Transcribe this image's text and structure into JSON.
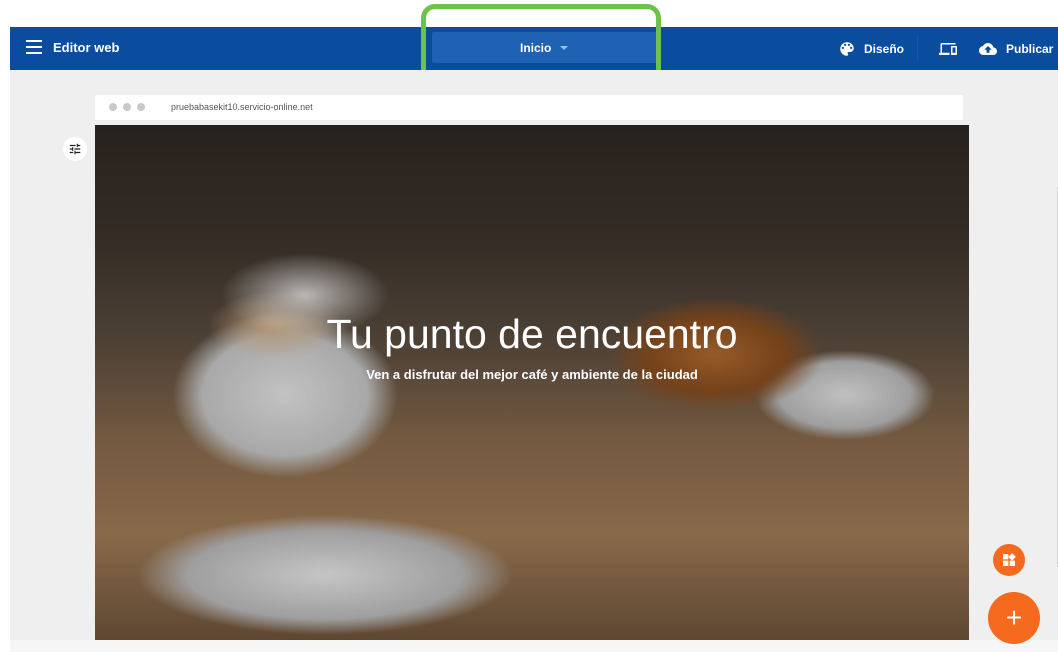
{
  "topbar": {
    "title": "Editor web",
    "page_selector": "Inicio",
    "design_label": "Diseño",
    "publish_label": "Publicar",
    "icons": {
      "menu": "menu-icon",
      "design": "palette-icon",
      "devices": "devices-icon",
      "publish": "cloud-upload-icon"
    }
  },
  "browser": {
    "url": "pruebabasekit10.servicio-online.net"
  },
  "hero": {
    "title": "Tu punto de encuentro",
    "subtitle": "Ven a disfrutar del mejor café y ambiente de la ciudad"
  },
  "fab": {
    "add_label": "+",
    "widgets_icon": "widgets-icon",
    "settings_icon": "tune-icon"
  },
  "colors": {
    "toolbar": "#0a4d9e",
    "selector": "#1f62b4",
    "highlight": "#6cc24a",
    "fab": "#f56a1e"
  }
}
